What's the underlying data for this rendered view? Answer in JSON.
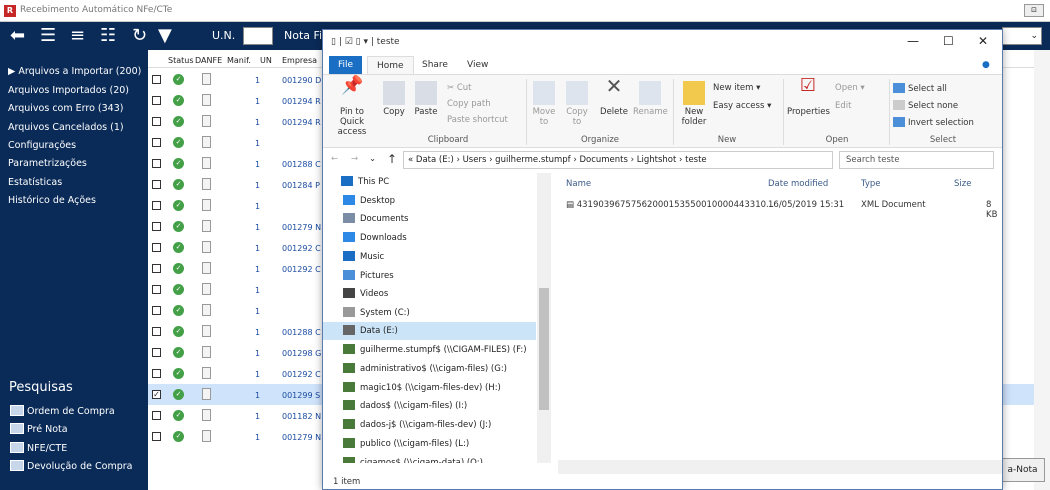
{
  "app": {
    "title": "Recebimento Automático NFe/CTe",
    "icon_letter": "R",
    "corner_btn": "⊡"
  },
  "toolbar": {
    "un_label": "U.N.",
    "nota_label": "Nota Fi",
    "icons": [
      "back-arrow-icon",
      "checklist-icon",
      "list-icon",
      "numbered-list-icon",
      "refresh-icon",
      "filter-icon"
    ],
    "combo_arrow": "⌄"
  },
  "sidebar": {
    "items": [
      "▶ Arquivos a Importar (200)",
      "Arquivos Importados (20)",
      "Arquivos com Erro (343)",
      "Arquivos Cancelados (1)",
      "Configurações",
      "Parametrizações",
      "Estatísticas",
      "Histórico de Ações"
    ],
    "pesquisas_title": "Pesquisas",
    "pesquisas": [
      "Ordem de Compra",
      "Pré Nota",
      "NFE/CTE",
      "Devolução de Compra"
    ]
  },
  "grid": {
    "headers": [
      "Status",
      "DANFE",
      "Manif.",
      "UN",
      "Empresa"
    ],
    "rows": [
      {
        "checked": false,
        "un": "1",
        "empresa": "001290 D"
      },
      {
        "checked": false,
        "un": "1",
        "empresa": "001294 R"
      },
      {
        "checked": false,
        "un": "1",
        "empresa": "001294 R"
      },
      {
        "checked": false,
        "un": "1",
        "empresa": ""
      },
      {
        "checked": false,
        "un": "1",
        "empresa": "001288 C"
      },
      {
        "checked": false,
        "un": "1",
        "empresa": "001284 P"
      },
      {
        "checked": false,
        "un": "1",
        "empresa": ""
      },
      {
        "checked": false,
        "un": "1",
        "empresa": "001279 N"
      },
      {
        "checked": false,
        "un": "1",
        "empresa": "001292 C"
      },
      {
        "checked": false,
        "un": "1",
        "empresa": "001292 C"
      },
      {
        "checked": false,
        "un": "1",
        "empresa": ""
      },
      {
        "checked": false,
        "un": "1",
        "empresa": ""
      },
      {
        "checked": false,
        "un": "1",
        "empresa": "001288 C"
      },
      {
        "checked": false,
        "un": "1",
        "empresa": "001298 G"
      },
      {
        "checked": false,
        "un": "1",
        "empresa": "001292 C"
      },
      {
        "checked": true,
        "un": "1",
        "empresa": "001299 S"
      },
      {
        "checked": false,
        "un": "1",
        "empresa": "001182 N"
      },
      {
        "checked": false,
        "un": "1",
        "empresa": "001279 N"
      }
    ],
    "nova_btn": "a-Nota"
  },
  "explorer": {
    "title": "teste",
    "quick_access": "▯ | ☑ ▯ ▾ |",
    "wc": {
      "min": "—",
      "max": "☐",
      "close": "✕"
    },
    "tabs": {
      "file": "File",
      "home": "Home",
      "share": "Share",
      "view": "View"
    },
    "ribbon": {
      "pin": "Pin to Quick access",
      "copy": "Copy",
      "paste": "Paste",
      "cut": "Cut",
      "copy_path": "Copy path",
      "paste_shortcut": "Paste shortcut",
      "move_to": "Move to",
      "copy_to": "Copy to",
      "delete": "Delete",
      "rename": "Rename",
      "new_folder": "New folder",
      "new_item": "New item ▾",
      "easy_access": "Easy access ▾",
      "properties": "Properties",
      "open": "Open ▾",
      "edit": "Edit",
      "select_all": "Select all",
      "select_none": "Select none",
      "invert": "Invert selection",
      "groups": {
        "clipboard": "Clipboard",
        "organize": "Organize",
        "new": "New",
        "open": "Open",
        "select": "Select"
      }
    },
    "address": "« Data (E:) › Users › guilherme.stumpf › Documents › Lightshot › teste",
    "search_placeholder": "Search teste",
    "nav": [
      "This PC",
      "Desktop",
      "Documents",
      "Downloads",
      "Music",
      "Pictures",
      "Videos",
      "System (C:)",
      "Data (E:)",
      "guilherme.stumpf$ (\\\\CIGAM-FILES) (F:)",
      "administrativo$ (\\\\cigam-files) (G:)",
      "magic10$ (\\\\cigam-files-dev) (H:)",
      "dados$ (\\\\cigam-files) (I:)",
      "dados-j$ (\\\\cigam-files-dev) (J:)",
      "publico (\\\\cigam-files) (L:)",
      "cigamos$ (\\\\cigam-data) (O:)"
    ],
    "columns": {
      "name": "Name",
      "date": "Date modified",
      "type": "Type",
      "size": "Size"
    },
    "file": {
      "name": "43190396757562000153550010000443310...",
      "date": "16/05/2019 15:31",
      "type": "XML Document",
      "size": "8 KB"
    },
    "status": "1 item"
  },
  "colors": {
    "navy": "#0a2b58",
    "accent": "#1a6fc4",
    "ok": "#43a047"
  }
}
